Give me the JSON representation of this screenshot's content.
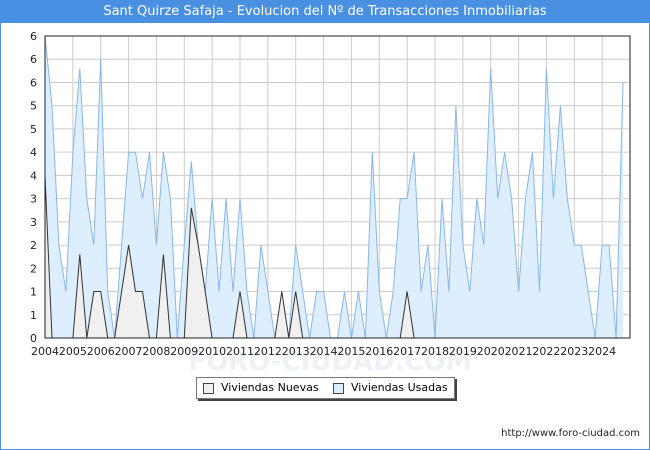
{
  "title": "Sant Quirze Safaja - Evolucion del Nº de Transacciones Inmobiliarias",
  "footer": "http://www.foro-ciudad.com",
  "legend": {
    "nuevas": "Viviendas Nuevas",
    "usadas": "Viviendas Usadas"
  },
  "watermark": "FORO-CIUDAD.COM",
  "colors": {
    "title_bg": "#4a90e2",
    "usadas_fill": "#ddeeff",
    "usadas_line": "#8ab6e8",
    "nuevas_fill": "#f0f0f0",
    "nuevas_line": "#333333",
    "grid": "#cccccc"
  },
  "chart_data": {
    "type": "area",
    "xlabel": "",
    "ylabel": "",
    "x_tick_labels": [
      "2004",
      "2005",
      "2006",
      "2007",
      "2008",
      "2009",
      "2010",
      "2011",
      "2012",
      "2013",
      "2014",
      "2015",
      "2016",
      "2017",
      "2018",
      "2019",
      "2020",
      "2021",
      "2022",
      "2023",
      "2024"
    ],
    "y_tick_labels": [
      "0",
      "1",
      "1",
      "2",
      "2",
      "3",
      "3",
      "4",
      "4",
      "5",
      "5",
      "6",
      "6",
      "6"
    ],
    "ylim": [
      0,
      6.5
    ],
    "x_range": [
      "2004-01",
      "2024-12"
    ],
    "grid": true,
    "legend_position": "bottom-center",
    "series": [
      {
        "name": "Viviendas Usadas",
        "x": [
          "2004-01",
          "2004-04",
          "2004-07",
          "2004-10",
          "2005-01",
          "2005-04",
          "2005-07",
          "2005-10",
          "2006-01",
          "2006-04",
          "2006-07",
          "2006-10",
          "2007-01",
          "2007-04",
          "2007-07",
          "2007-10",
          "2008-01",
          "2008-04",
          "2008-07",
          "2008-10",
          "2009-01",
          "2009-04",
          "2009-07",
          "2009-10",
          "2010-01",
          "2010-04",
          "2010-07",
          "2010-10",
          "2011-01",
          "2011-04",
          "2011-07",
          "2011-10",
          "2012-01",
          "2012-04",
          "2012-07",
          "2012-10",
          "2013-01",
          "2013-04",
          "2013-07",
          "2013-10",
          "2014-01",
          "2014-04",
          "2014-07",
          "2014-10",
          "2015-01",
          "2015-04",
          "2015-07",
          "2015-10",
          "2016-01",
          "2016-04",
          "2016-07",
          "2016-10",
          "2017-01",
          "2017-04",
          "2017-07",
          "2017-10",
          "2018-01",
          "2018-04",
          "2018-07",
          "2018-10",
          "2019-01",
          "2019-04",
          "2019-07",
          "2019-10",
          "2020-01",
          "2020-04",
          "2020-07",
          "2020-10",
          "2021-01",
          "2021-04",
          "2021-07",
          "2021-10",
          "2022-01",
          "2022-04",
          "2022-07",
          "2022-10",
          "2023-01",
          "2023-04",
          "2023-07",
          "2023-10",
          "2024-01",
          "2024-04",
          "2024-07",
          "2024-10"
        ],
        "values": [
          6.5,
          5,
          2,
          1,
          4,
          5.8,
          3,
          2,
          6,
          1,
          0,
          2,
          4,
          4,
          3,
          4,
          2,
          4,
          3,
          0,
          2,
          3.8,
          2,
          1,
          3,
          1,
          3,
          1,
          3,
          1,
          0,
          2,
          1,
          0,
          0,
          0,
          2,
          1,
          0,
          1,
          1,
          0,
          0,
          1,
          0,
          1,
          0,
          4,
          1,
          0,
          1,
          3,
          3,
          4,
          1,
          2,
          0,
          3,
          1,
          5,
          2,
          1,
          3,
          2,
          5.8,
          3,
          4,
          3,
          1,
          3,
          4,
          1,
          5.8,
          3,
          5,
          3,
          2,
          2,
          1,
          0,
          2,
          2,
          0,
          5.5
        ]
      },
      {
        "name": "Viviendas Nuevas",
        "x": [
          "2004-01",
          "2004-04",
          "2004-07",
          "2004-10",
          "2005-01",
          "2005-04",
          "2005-07",
          "2005-10",
          "2006-01",
          "2006-04",
          "2006-07",
          "2006-10",
          "2007-01",
          "2007-04",
          "2007-07",
          "2007-10",
          "2008-01",
          "2008-04",
          "2008-07",
          "2008-10",
          "2009-01",
          "2009-04",
          "2009-07",
          "2009-10",
          "2010-01",
          "2010-04",
          "2010-07",
          "2010-10",
          "2011-01",
          "2011-04",
          "2011-07",
          "2011-10",
          "2012-01",
          "2012-04",
          "2012-07",
          "2012-10",
          "2013-01",
          "2013-04",
          "2013-07",
          "2013-10",
          "2014-01",
          "2014-04",
          "2014-07",
          "2014-10",
          "2015-01",
          "2015-04",
          "2015-07",
          "2015-10",
          "2016-01",
          "2016-04",
          "2016-07",
          "2016-10",
          "2017-01",
          "2017-04",
          "2017-07",
          "2017-10",
          "2018-01",
          "2018-04",
          "2018-07",
          "2018-10",
          "2019-01",
          "2019-04",
          "2019-07",
          "2019-10",
          "2020-01",
          "2020-04",
          "2020-07",
          "2020-10",
          "2021-01",
          "2021-04",
          "2021-07",
          "2021-10",
          "2022-01",
          "2022-04",
          "2022-07",
          "2022-10",
          "2023-01",
          "2023-04",
          "2023-07",
          "2023-10",
          "2024-01",
          "2024-04",
          "2024-07",
          "2024-10"
        ],
        "values": [
          3.5,
          0,
          0,
          0,
          0,
          1.8,
          0,
          1,
          1,
          0,
          0,
          1,
          2,
          1,
          1,
          0,
          0,
          1.8,
          0,
          0,
          0,
          2.8,
          2,
          1,
          0,
          0,
          0,
          0,
          1,
          0,
          0,
          0,
          0,
          0,
          1,
          0,
          1,
          0,
          0,
          0,
          0,
          0,
          0,
          0,
          0,
          0,
          0,
          0,
          0,
          0,
          0,
          0,
          1,
          0,
          0,
          0,
          0,
          0,
          0,
          0,
          0,
          0,
          0,
          0,
          0,
          0,
          0,
          0,
          0,
          0,
          0,
          0,
          0,
          0,
          0,
          0,
          0,
          0,
          0,
          0,
          0,
          0,
          0,
          0
        ]
      }
    ]
  }
}
